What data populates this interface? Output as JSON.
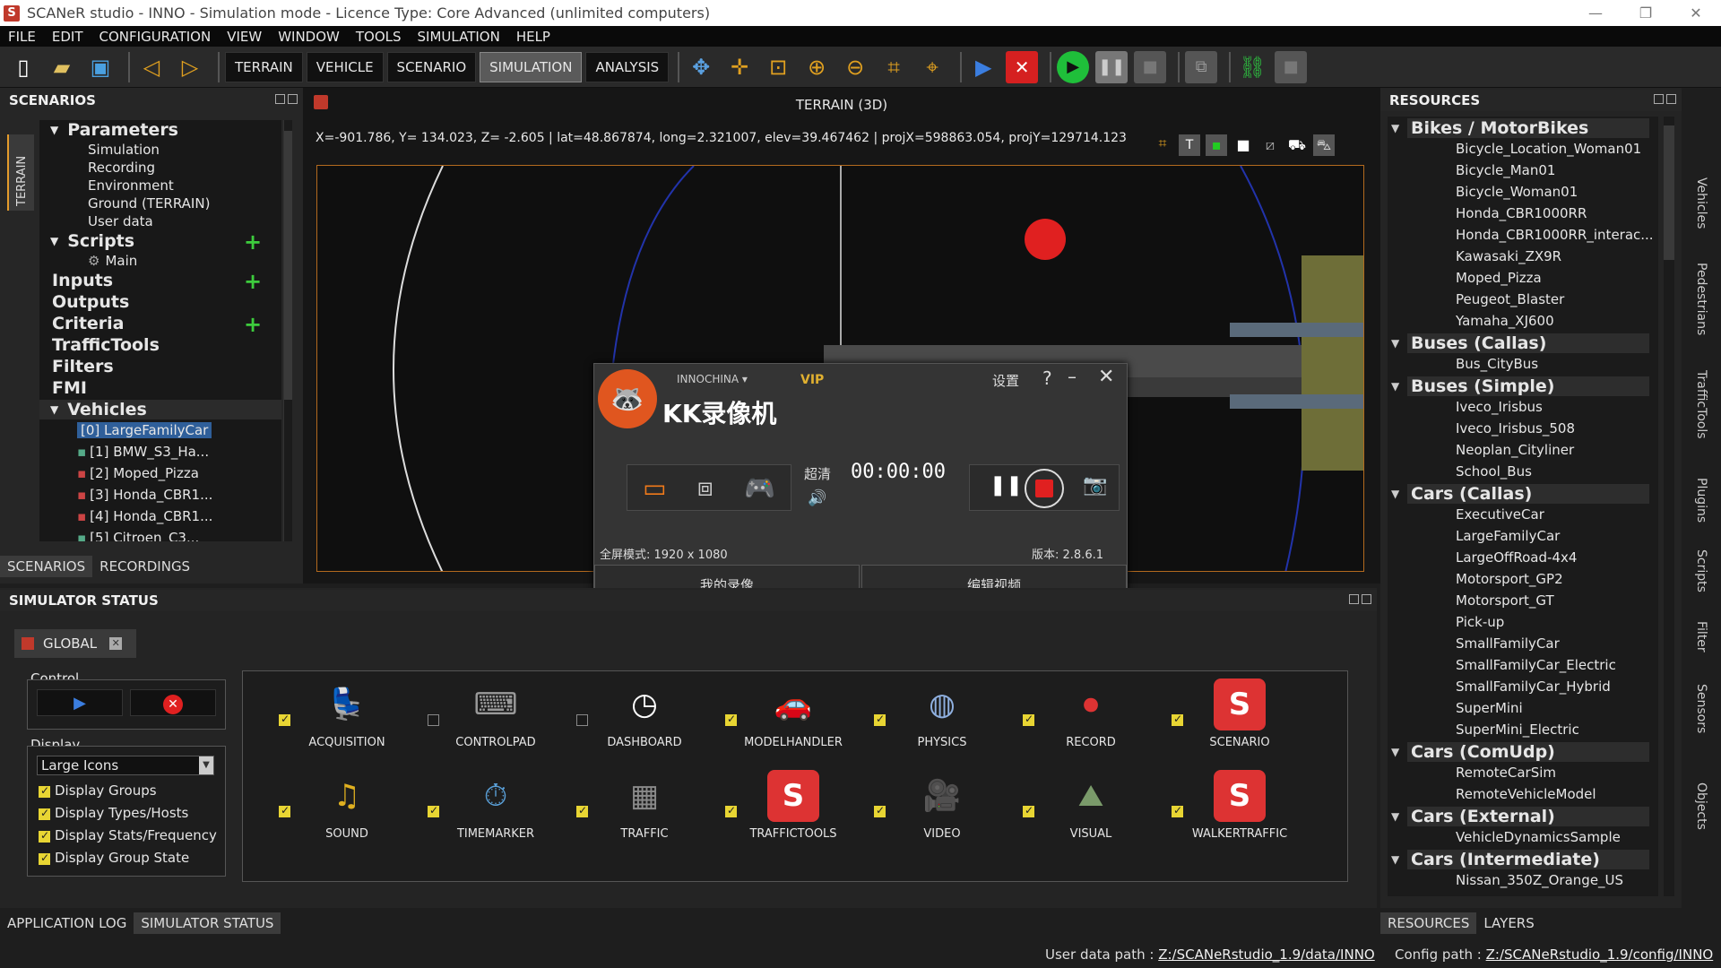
{
  "window": {
    "title": "SCANeR studio - INNO - Simulation mode - Licence Type: Core Advanced (unlimited computers)",
    "controls": [
      "—",
      "❐",
      "✕"
    ]
  },
  "menu": [
    "FILE",
    "EDIT",
    "CONFIGURATION",
    "VIEW",
    "WINDOW",
    "TOOLS",
    "SIMULATION",
    "HELP"
  ],
  "modes": [
    "TERRAIN",
    "VEHICLE",
    "SCENARIO",
    "SIMULATION",
    "ANALYSIS"
  ],
  "active_mode": "SIMULATION",
  "scenarios": {
    "header": "SCENARIOS",
    "side_tab": "TERRAIN",
    "parameters": "Parameters",
    "param_items": [
      "Simulation",
      "Recording",
      "Environment",
      "Ground (TERRAIN)",
      "User data"
    ],
    "scripts": "Scripts",
    "script_main": "Main",
    "inputs": "Inputs",
    "outputs": "Outputs",
    "criteria": "Criteria",
    "traffic_tools": "TrafficTools",
    "filters": "Filters",
    "fmi": "FMI",
    "vehicles": "Vehicles",
    "vehicle_items": [
      "[0] LargeFamilyCar",
      "[1] BMW_S3_Ha...",
      "[2] Moped_Pizza",
      "[3] Honda_CBR1...",
      "[4] Honda_CBR1...",
      "[5] Citroen_C3..."
    ],
    "tabs": [
      "SCENARIOS",
      "RECORDINGS"
    ]
  },
  "viewport": {
    "title": "TERRAIN (3D)",
    "coords": "X=-901.786, Y= 134.023, Z=  -2.605 | lat=48.867874, long=2.321007, elev=39.467462 | projX=598863.054, projY=129714.123"
  },
  "kk_recorder": {
    "user": "INNOCHINA",
    "vip": "VIP",
    "settings": "设置",
    "help": "?",
    "app_name": "KK录像机",
    "quality": "超清",
    "timer": "00:00:00",
    "fullscreen_info": "全屏模式: 1920 x 1080",
    "version": "版本: 2.8.6.1",
    "my_recordings": "我的录像",
    "edit_video": "编辑视频"
  },
  "simulator_status": {
    "header": "SIMULATOR STATUS",
    "global_tab": "GLOBAL",
    "control_label": "Control",
    "display_label": "Display",
    "display_select": "Large Icons",
    "display_options": [
      "Display Groups",
      "Display Types/Hosts",
      "Display Stats/Frequency",
      "Display Group State"
    ],
    "modules": [
      {
        "name": "ACQUISITION",
        "checked": true,
        "icon": "seat-icon",
        "color": "#c0392b"
      },
      {
        "name": "CONTROLPAD",
        "checked": false,
        "icon": "keyboard-icon",
        "color": "#9a9a9a"
      },
      {
        "name": "DASHBOARD",
        "checked": false,
        "icon": "gauge-icon",
        "color": "#ffffff"
      },
      {
        "name": "MODELHANDLER",
        "checked": true,
        "icon": "car-icon",
        "color": "#4a8fd4"
      },
      {
        "name": "PHYSICS",
        "checked": true,
        "icon": "globe-icon",
        "color": "#8fb0e0"
      },
      {
        "name": "RECORD",
        "checked": true,
        "icon": "rec-icon",
        "color": "#d33"
      },
      {
        "name": "SCENARIO",
        "checked": true,
        "icon": "scaner-s-icon",
        "color": "#d33"
      },
      {
        "name": "SOUND",
        "checked": true,
        "icon": "music-note-icon",
        "color": "#e0b020"
      },
      {
        "name": "TIMEMARKER",
        "checked": true,
        "icon": "stopwatch-icon",
        "color": "#5aa0d8"
      },
      {
        "name": "TRAFFIC",
        "checked": true,
        "icon": "traffic-icon",
        "color": "#8a8a8a"
      },
      {
        "name": "TRAFFICTOOLS",
        "checked": true,
        "icon": "scaner-s-icon",
        "color": "#d33"
      },
      {
        "name": "VIDEO",
        "checked": true,
        "icon": "camera-icon",
        "color": "#8a8a8a"
      },
      {
        "name": "VISUAL",
        "checked": true,
        "icon": "road-icon",
        "color": "#7a9a6a"
      },
      {
        "name": "WALKERTRAFFIC",
        "checked": true,
        "icon": "scaner-s-icon",
        "color": "#d33"
      }
    ]
  },
  "bottom_tabs": [
    "APPLICATION LOG",
    "SIMULATOR STATUS"
  ],
  "resources": {
    "header": "RESOURCES",
    "groups": [
      {
        "name": "Bikes / MotorBikes",
        "items": [
          "Bicycle_Location_Woman01",
          "Bicycle_Man01",
          "Bicycle_Woman01",
          "Honda_CBR1000RR",
          "Honda_CBR1000RR_interac...",
          "Kawasaki_ZX9R",
          "Moped_Pizza",
          "Peugeot_Blaster",
          "Yamaha_XJ600"
        ]
      },
      {
        "name": "Buses (Callas)",
        "items": [
          "Bus_CityBus"
        ]
      },
      {
        "name": "Buses (Simple)",
        "items": [
          "Iveco_Irisbus",
          "Iveco_Irisbus_508",
          "Neoplan_Cityliner",
          "School_Bus"
        ]
      },
      {
        "name": "Cars (Callas)",
        "items": [
          "ExecutiveCar",
          "LargeFamilyCar",
          "LargeOffRoad-4x4",
          "Motorsport_GP2",
          "Motorsport_GT",
          "Pick-up",
          "SmallFamilyCar",
          "SmallFamilyCar_Electric",
          "SmallFamilyCar_Hybrid",
          "SuperMini",
          "SuperMini_Electric"
        ]
      },
      {
        "name": "Cars (ComUdp)",
        "items": [
          "RemoteCarSim",
          "RemoteVehicleModel"
        ]
      },
      {
        "name": "Cars (External)",
        "items": [
          "VehicleDynamicsSample"
        ]
      },
      {
        "name": "Cars (Intermediate)",
        "items": [
          "Nissan_350Z_Orange_US"
        ]
      }
    ],
    "side_tabs": [
      "Vehicles",
      "Pedestrians",
      "TrafficTools",
      "Plugins",
      "Scripts",
      "Filter",
      "Sensors",
      "Objects"
    ],
    "tabs": [
      "RESOURCES",
      "LAYERS"
    ]
  },
  "statusbar": {
    "user_label": "User data path :",
    "user_path": "Z:/SCANeRstudio_1.9/data/INNO",
    "config_label": "Config path :",
    "config_path": "Z:/SCANeRstudio_1.9/config/INNO"
  },
  "colors": {
    "accent": "#e39b2b",
    "selection": "#2f5f9a",
    "add": "#3dcc3d",
    "record": "#e02020"
  }
}
